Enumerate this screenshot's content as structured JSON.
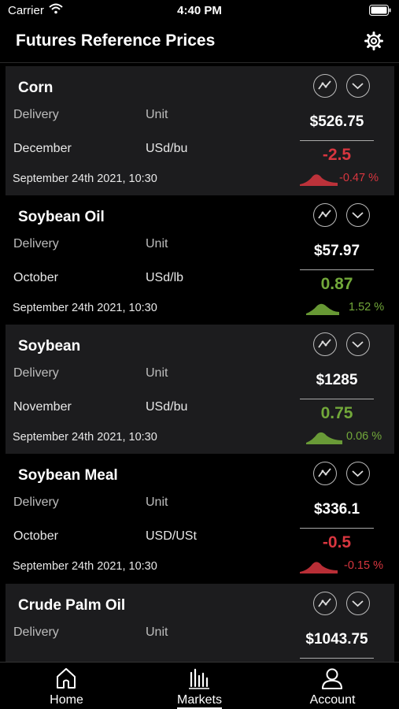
{
  "status_bar": {
    "carrier": "Carrier",
    "time": "4:40 PM",
    "icons": [
      "wifi-icon",
      "battery-icon"
    ]
  },
  "header": {
    "title": "Futures Reference Prices",
    "settings_icon": "gear-icon"
  },
  "labels": {
    "delivery": "Delivery",
    "unit": "Unit"
  },
  "colors": {
    "negative": "#d8363f",
    "positive": "#72a83a",
    "card_alt_bg": "#1c1c1e"
  },
  "cards": [
    {
      "name": "Corn",
      "delivery": "December",
      "unit": "USd/bu",
      "date": "September 24th 2021, 10:30",
      "price": "$526.75",
      "change": "-2.5",
      "percent": "-0.47 %",
      "direction": "down"
    },
    {
      "name": "Soybean Oil",
      "delivery": "October",
      "unit": "USd/lb",
      "date": "September 24th 2021, 10:30",
      "price": "$57.97",
      "change": "0.87",
      "percent": "1.52 %",
      "direction": "up"
    },
    {
      "name": "Soybean",
      "delivery": "November",
      "unit": "USd/bu",
      "date": "September 24th 2021, 10:30",
      "price": "$1285",
      "change": "0.75",
      "percent": "0.06 %",
      "direction": "up"
    },
    {
      "name": "Soybean Meal",
      "delivery": "October",
      "unit": "USD/USt",
      "date": "September 24th 2021, 10:30",
      "price": "$336.1",
      "change": "-0.5",
      "percent": "-0.15 %",
      "direction": "down"
    },
    {
      "name": "Crude Palm Oil",
      "delivery": "",
      "unit": "",
      "date": "",
      "price": "$1043.75",
      "change": "",
      "percent": "",
      "direction": ""
    }
  ],
  "tabs": [
    {
      "label": "Home",
      "icon": "home-icon",
      "active": false
    },
    {
      "label": "Markets",
      "icon": "markets-icon",
      "active": true
    },
    {
      "label": "Account",
      "icon": "account-icon",
      "active": false
    }
  ]
}
